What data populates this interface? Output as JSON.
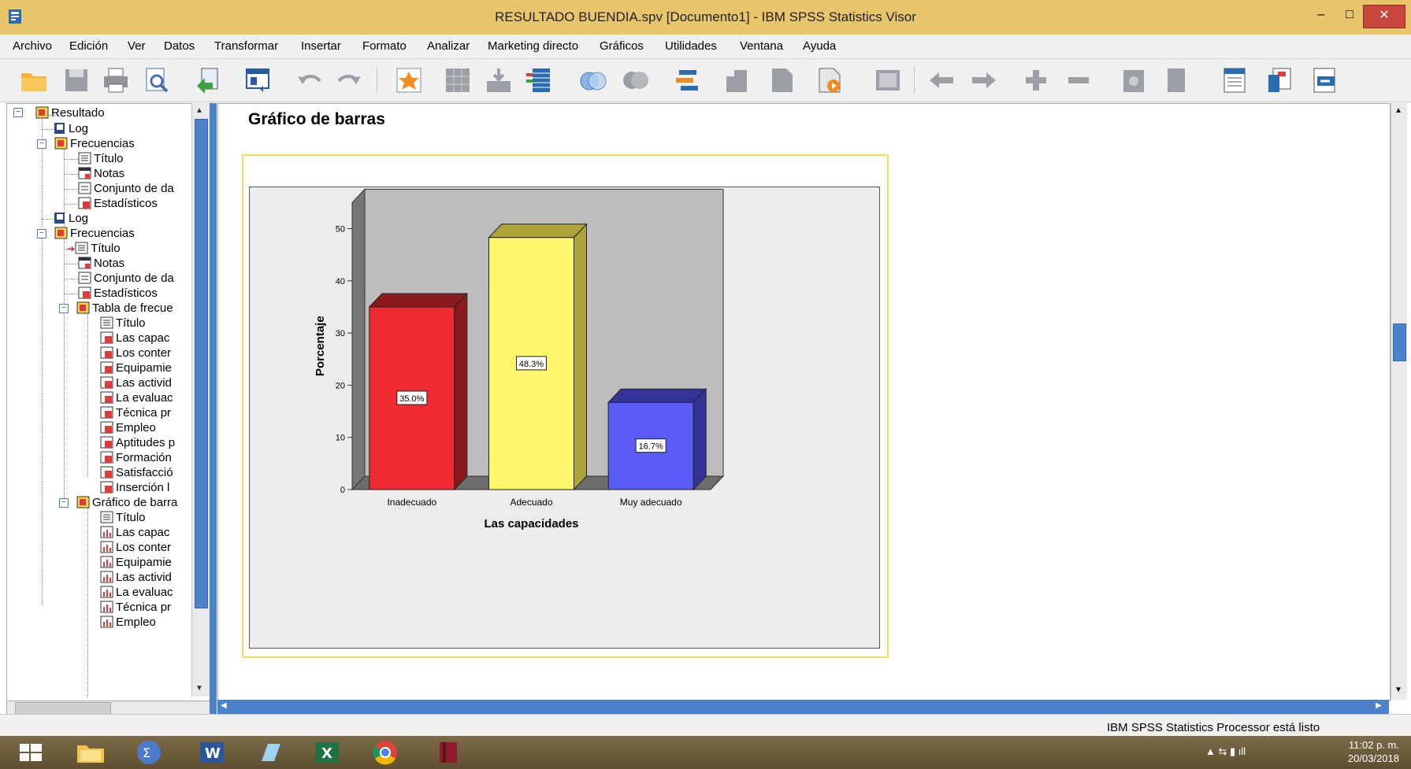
{
  "window": {
    "title": "RESULTADO BUENDIA.spv [Documento1] - IBM SPSS Statistics Visor",
    "min_label": "–",
    "max_label": "□",
    "close_label": "✕"
  },
  "menu": [
    "Archivo",
    "Edición",
    "Ver",
    "Datos",
    "Transformar",
    "Insertar",
    "Formato",
    "Analizar",
    "Marketing directo",
    "Gráficos",
    "Utilidades",
    "Ventana",
    "Ayuda"
  ],
  "toolbar_icons": [
    "open-folder-icon",
    "save-icon",
    "print-icon",
    "print-preview-icon",
    "export-icon",
    "recall-dialog-icon",
    "undo-icon",
    "redo-icon",
    "goto-data-icon",
    "goto-case-icon",
    "goto-variable-icon",
    "variables-icon",
    "show-all-icon",
    "select-cases-icon",
    "weight-cases-icon",
    "split-file-icon",
    "value-labels-icon",
    "use-sets-icon",
    "designate-window-icon",
    "promote-icon",
    "demote-icon",
    "expand-icon",
    "collapse-icon",
    "show-icon",
    "hide-icon",
    "insert-heading-icon",
    "insert-title-icon",
    "insert-text-icon"
  ],
  "outline": {
    "nodes": [
      {
        "label": "Resultado",
        "icon": "output-book-icon"
      },
      {
        "label": "Log",
        "icon": "log-icon"
      },
      {
        "label": "Frecuencias",
        "icon": "procedure-book-icon"
      },
      {
        "label": "Título",
        "icon": "title-icon"
      },
      {
        "label": "Notas",
        "icon": "notes-icon"
      },
      {
        "label": "Conjunto de da",
        "icon": "dataset-icon"
      },
      {
        "label": "Estadísticos",
        "icon": "table-icon"
      },
      {
        "label": "Log",
        "icon": "log-icon"
      },
      {
        "label": "Frecuencias",
        "icon": "procedure-book-icon"
      },
      {
        "label": "Título",
        "icon": "title-icon"
      },
      {
        "label": "Notas",
        "icon": "notes-icon"
      },
      {
        "label": "Conjunto de da",
        "icon": "dataset-icon"
      },
      {
        "label": "Estadísticos",
        "icon": "table-icon"
      },
      {
        "label": "Tabla de frecue",
        "icon": "procedure-book-icon"
      },
      {
        "label": "Título",
        "icon": "title-icon"
      },
      {
        "label": "Las capac",
        "icon": "table-icon"
      },
      {
        "label": "Los conter",
        "icon": "table-icon"
      },
      {
        "label": "Equipamie",
        "icon": "table-icon"
      },
      {
        "label": "Las activid",
        "icon": "table-icon"
      },
      {
        "label": "La evaluac",
        "icon": "table-icon"
      },
      {
        "label": "Técnica pr",
        "icon": "table-icon"
      },
      {
        "label": "Empleo",
        "icon": "table-icon"
      },
      {
        "label": "Aptitudes p",
        "icon": "table-icon"
      },
      {
        "label": "Formación",
        "icon": "table-icon"
      },
      {
        "label": "Satisfacció",
        "icon": "table-icon"
      },
      {
        "label": "Inserción l",
        "icon": "table-icon"
      },
      {
        "label": "Gráfico de barra",
        "icon": "procedure-book-icon"
      },
      {
        "label": "Título",
        "icon": "title-icon"
      },
      {
        "label": "Las capac",
        "icon": "chart-icon"
      },
      {
        "label": "Los conter",
        "icon": "chart-icon"
      },
      {
        "label": "Equipamie",
        "icon": "chart-icon"
      },
      {
        "label": "Las activid",
        "icon": "chart-icon"
      },
      {
        "label": "La evaluac",
        "icon": "chart-icon"
      },
      {
        "label": "Técnica pr",
        "icon": "chart-icon"
      },
      {
        "label": "Empleo",
        "icon": "chart-icon"
      }
    ]
  },
  "content": {
    "heading": "Gráfico de barras"
  },
  "chart_data": {
    "type": "bar",
    "categories": [
      "Inadecuado",
      "Adecuado",
      "Muy adecuado"
    ],
    "values": [
      35.0,
      48.3,
      16.7
    ],
    "data_labels": [
      "35.0%",
      "48.3%",
      "16.7%"
    ],
    "colors": [
      "#ee2b33",
      "#fdf66b",
      "#5b5bf6"
    ],
    "side_colors": [
      "#8b1a1f",
      "#aea53a",
      "#33339a"
    ],
    "xlabel": "Las capacidades",
    "ylabel": "Porcentaje",
    "ylim": [
      0,
      55
    ],
    "yticks": [
      0,
      10,
      20,
      30,
      40,
      50
    ],
    "style": "3d"
  },
  "status": {
    "text": "IBM SPSS Statistics Processor está listo"
  },
  "taskbar": {
    "apps": [
      "windows-start-icon",
      "file-explorer-icon",
      "spss-sum-icon",
      "word-icon",
      "notes-app-icon",
      "excel-icon",
      "chrome-icon",
      "books-app-icon"
    ],
    "time": "11:02 p. m.",
    "date": "20/03/2018"
  }
}
